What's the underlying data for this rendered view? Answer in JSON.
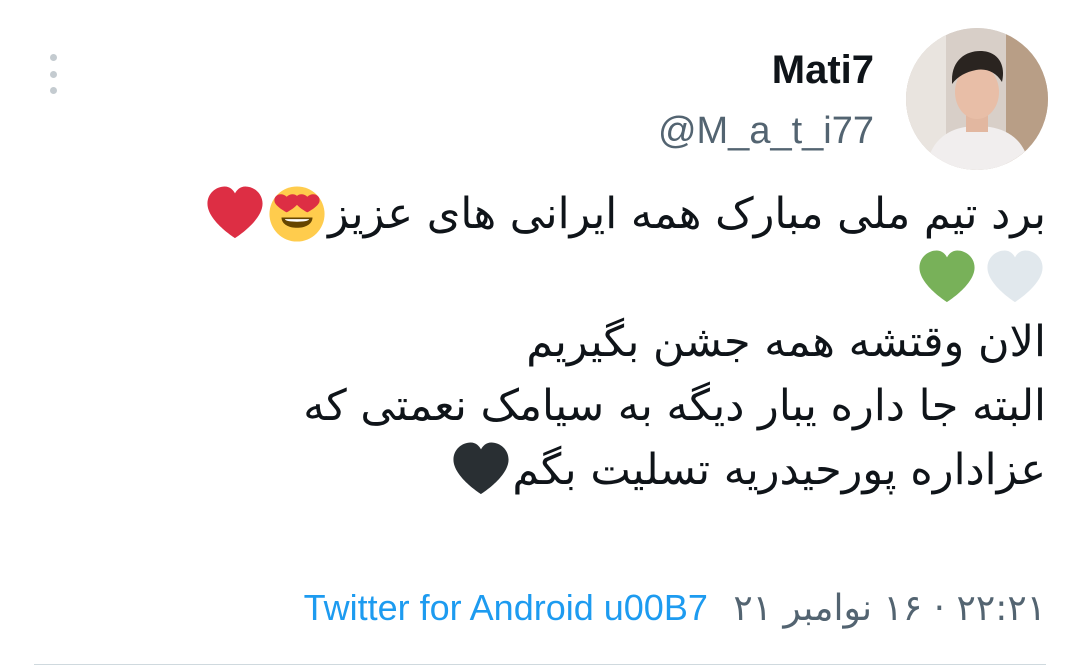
{
  "tweet": {
    "display_name": "Mati7",
    "handle": "@M_a_t_i77",
    "lines": [
      "برد تیم ملی مبارک همه ایرانی های عزیز",
      "",
      "الان وقتشه همه جشن بگیریم",
      "البته جا داره یبار دیگه به سیامک نعمتی که",
      "عزاداره پورحیدریه تسلیت بگم"
    ],
    "emojis": {
      "line1": [
        "heart-eyes-emoji",
        "red-heart-emoji"
      ],
      "line2": [
        "white-heart-emoji",
        "green-heart-emoji"
      ],
      "line5": [
        "black-heart-emoji"
      ]
    },
    "timestamp": "۲۲:۲۱ · ۱۶ نوامبر ۲۱",
    "source": "Twitter for Android u00B7"
  },
  "colors": {
    "text": "#0f1419",
    "secondary": "#536471",
    "link": "#1d9bf0",
    "red_heart": "#dd2e44",
    "green_heart": "#78b159",
    "white_heart": "#e1e8ed",
    "black_heart": "#292f33",
    "divider": "#cfd9de"
  }
}
